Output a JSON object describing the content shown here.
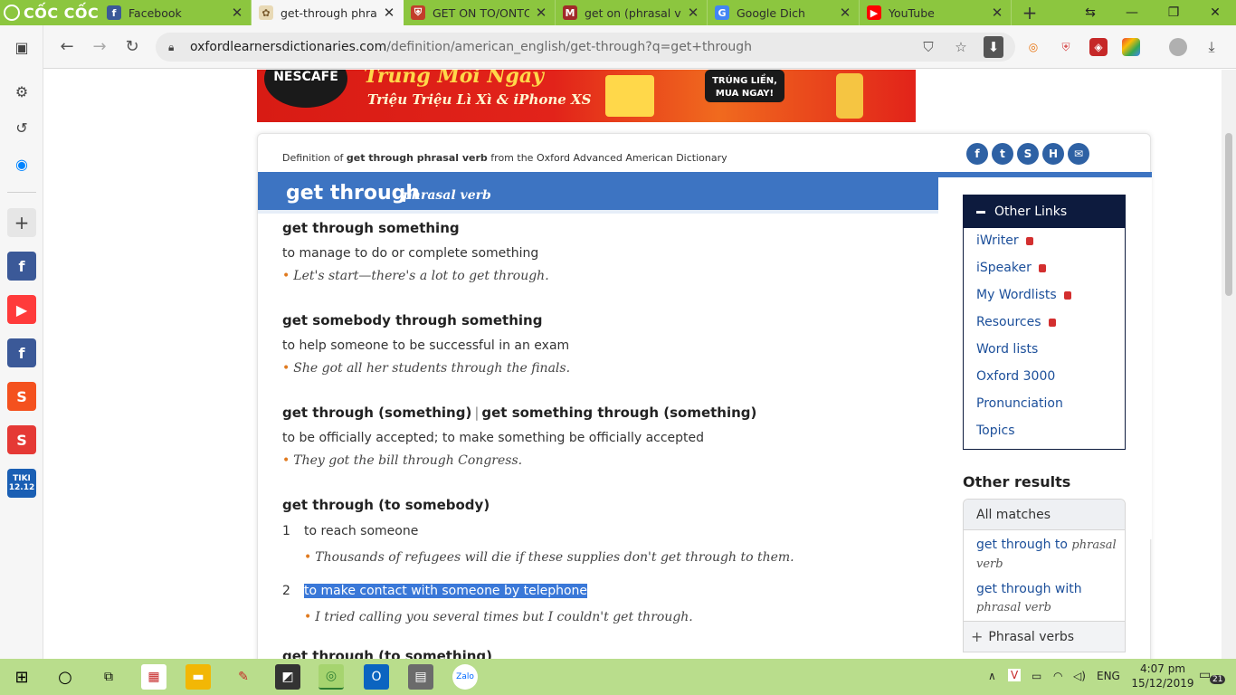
{
  "browser": {
    "brand": "CỐC CỐC",
    "tabs": [
      {
        "title": "Facebook",
        "icon": "facebook-icon",
        "color": "#3b5998"
      },
      {
        "title": "get-through phrasal",
        "icon": "oxford-icon",
        "color": "#7a5b2e",
        "active": true
      },
      {
        "title": "GET ON TO/ONTO ST",
        "icon": "cambridge-icon",
        "color": "#c23d2b"
      },
      {
        "title": "get on (phrasal verb)",
        "icon": "dictionary-icon",
        "color": "#a12a2a"
      },
      {
        "title": "Google Dich",
        "icon": "google-translate-icon",
        "color": "#4285f4"
      },
      {
        "title": "YouTube",
        "icon": "youtube-icon",
        "color": "#ff0000"
      }
    ],
    "url_host": "oxfordlearnersdictionaries.com",
    "url_path": "/definition/american_english/get-through?q=get+through"
  },
  "ad": {
    "brand": "NESCAFE",
    "line1": "Trúng Mỗi Ngày",
    "line2": "Triệu Triệu Lì Xì & iPhone XS",
    "cta": "TRÚNG LIỀN, MUA NGAY!"
  },
  "entry": {
    "def_of_prefix": "Definition of ",
    "def_of_term": "get through phrasal verb",
    "def_of_suffix": " from the Oxford Advanced American Dictionary",
    "headword": "get through",
    "pos": "phrasal verb",
    "senses": [
      {
        "pv": "get through something",
        "def": "to manage to do or complete something",
        "ex": "Let's start—there's a lot to get through."
      },
      {
        "pv": "get somebody through something",
        "def": "to help someone to be successful in an exam",
        "ex": "She got all her students through the finals."
      },
      {
        "pv_a": "get through (something)",
        "pv_sep": "|",
        "pv_b": "get something through (something)",
        "def": "to be officially accepted; to make something be officially accepted",
        "ex": "They got the bill through Congress."
      },
      {
        "pv": "get through (to somebody)",
        "subs": [
          {
            "n": "1",
            "def": "to reach someone",
            "ex": "Thousands of refugees will die if these supplies don't get through to them."
          },
          {
            "n": "2",
            "def": "to make contact with someone by telephone",
            "ex": "I tried calling you several times but I couldn't get through."
          }
        ]
      },
      {
        "pv": "get through (to something)"
      }
    ]
  },
  "other_links": {
    "title": "Other Links",
    "items": [
      "iWriter",
      "iSpeaker",
      "My Wordlists",
      "Resources",
      "Word lists",
      "Oxford 3000",
      "Pronunciation",
      "Topics"
    ]
  },
  "other_results": {
    "title": "Other results",
    "all_matches": "All matches",
    "items": [
      {
        "term": "get through to",
        "pos": "phrasal verb"
      },
      {
        "term": "get through with",
        "pos": "phrasal verb"
      }
    ],
    "phrasal_verbs": "Phrasal verbs"
  },
  "taskbar": {
    "lang": "ENG",
    "time": "4:07 pm",
    "date": "15/12/2019",
    "notifications": "21"
  }
}
